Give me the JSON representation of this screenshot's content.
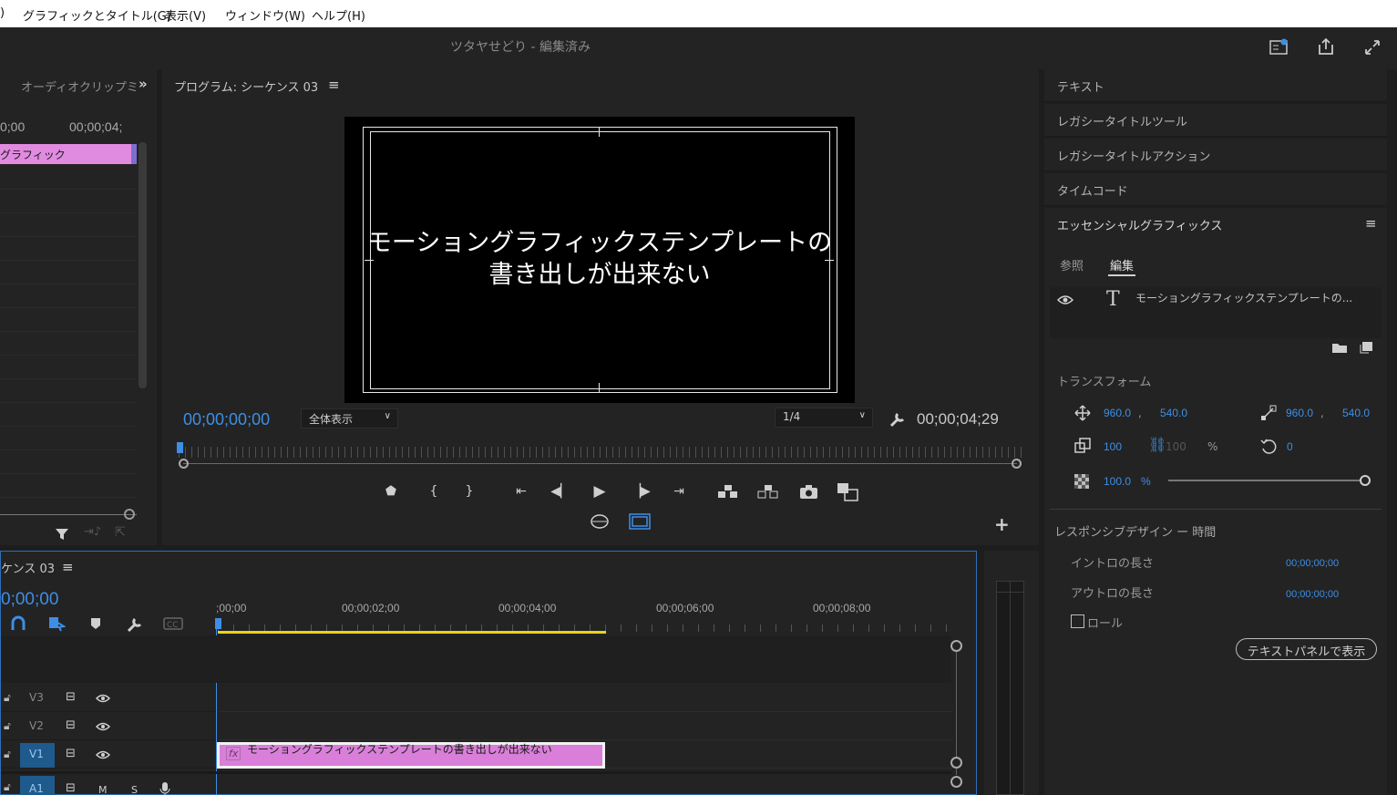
{
  "menubar": {
    "items": [
      ")",
      "グラフィックとタイトル(G)",
      "表示(V)",
      "ウィンドウ(W)",
      "ヘルプ(H)"
    ]
  },
  "titlebar": {
    "title": "ツタヤせどり - 編集済み"
  },
  "audio_panel": {
    "header": "オーディオクリップミ",
    "tc_left": "0;00",
    "tc_right": "00;00;04;",
    "clip_label": "グラフィック"
  },
  "program": {
    "header": "プログラム: シーケンス 03",
    "video_text_line1": "モーショングラフィックステンプレートの",
    "video_text_line2": "書き出しが出来ない",
    "current_tc": "00;00;00;00",
    "fit_select": "全体表示",
    "resolution_select": "1/4",
    "duration_tc": "00;00;04;29"
  },
  "right_panel": {
    "rows": [
      "テキスト",
      "レガシータイトルツール",
      "レガシータイトルアクション",
      "タイムコード"
    ],
    "eg_header": "エッセンシャルグラフィックス",
    "tab_browse": "参照",
    "tab_edit": "編集",
    "layer_name": "モーショングラフィックステンプレートの...",
    "transform_label": "トランスフォーム",
    "pos_x": "960.0",
    "pos_y": "540.0",
    "anchor_x": "960.0",
    "anchor_y": "540.0",
    "scale": "100",
    "scale_w": "100",
    "percent": "%",
    "rotation": "0",
    "opacity": "100.0",
    "opacity_unit": "%",
    "comma": ",",
    "responsive_label": "レスポンシブデザイン ー 時間",
    "intro_label": "イントロの長さ",
    "intro_value": "00;00;00;00",
    "outro_label": "アウトロの長さ",
    "outro_value": "00;00;00;00",
    "roll_label": "ロール",
    "text_panel_button": "テキストパネルで表示"
  },
  "timeline": {
    "header": "ケンス 03",
    "current_tc": "0;00;00",
    "ruler": [
      ";00;00",
      "00;00;02;00",
      "00;00;04;00",
      "00;00;06;00",
      "00;00;08;00"
    ],
    "tracks": [
      {
        "name": "V3"
      },
      {
        "name": "V2"
      },
      {
        "name": "V1"
      },
      {
        "name": "A1",
        "m": "M",
        "s": "S"
      }
    ],
    "clip_fx": "fx",
    "clip_label": "モーショングラフィックステンプレートの書き出しが出来ない"
  },
  "colors": {
    "accent_blue": "#3e8ee6",
    "clip_pink": "#d97fd9",
    "work_area_yellow": "#e8d51a"
  }
}
